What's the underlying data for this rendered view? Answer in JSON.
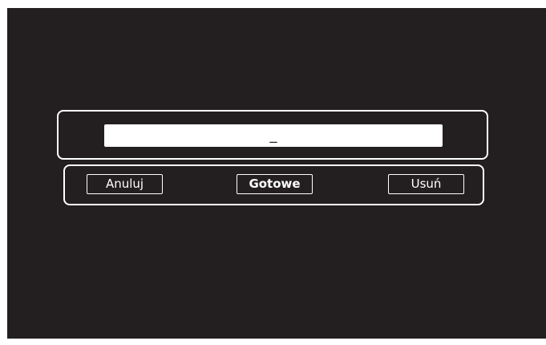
{
  "text_input": {
    "value": "_"
  },
  "buttons": {
    "cancel_label": "Anuluj",
    "done_label": "Gotowe",
    "delete_label": "Usuń"
  },
  "colors": {
    "background": "#231f20",
    "foreground": "#ffffff"
  }
}
